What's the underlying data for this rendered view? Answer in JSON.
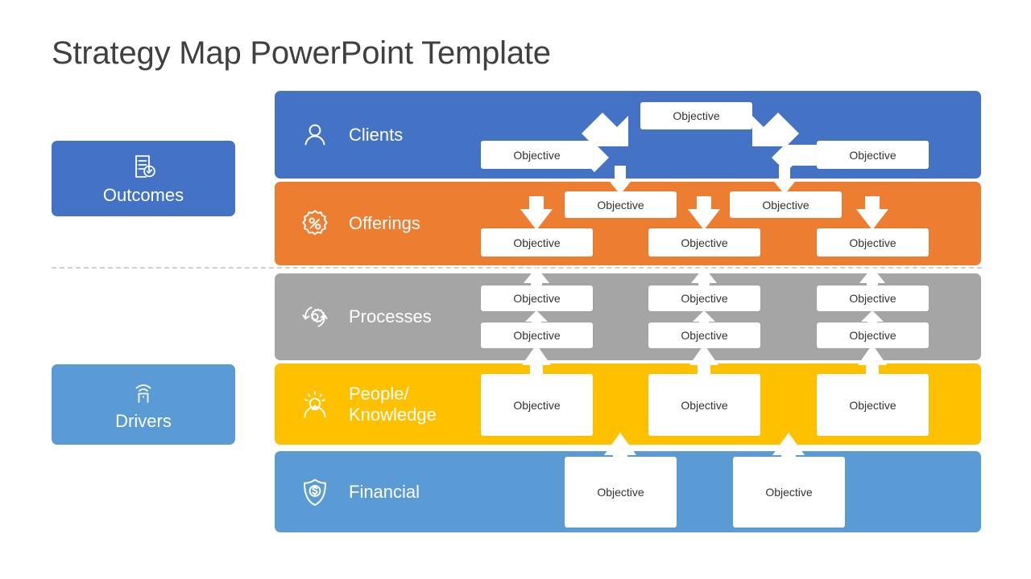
{
  "title": "Strategy Map PowerPoint Template",
  "colors": {
    "title_text": "#404040",
    "outcomes": "#4472C4",
    "drivers": "#5B9BD5",
    "clients": "#4472C4",
    "offerings": "#ED7D31",
    "processes": "#A5A5A5",
    "people": "#FFC000",
    "financial": "#5B9BD5",
    "objective_box": "#FFFFFF",
    "objective_text": "#333333",
    "divider": "#D0D0D0",
    "arrow": "#FFFFFF"
  },
  "categories": [
    {
      "key": "outcomes",
      "label": "Outcomes",
      "icon": "checklist-check-icon"
    },
    {
      "key": "drivers",
      "label": "Drivers",
      "icon": "signal-broadcast-icon"
    }
  ],
  "bands": [
    {
      "key": "clients",
      "label": "Clients",
      "icon": "person-icon"
    },
    {
      "key": "offerings",
      "label": "Offerings",
      "icon": "percent-badge-icon"
    },
    {
      "key": "processes",
      "label": "Processes",
      "icon": "gear-cycle-icon"
    },
    {
      "key": "people",
      "label": "People/\nKnowledge",
      "icon": "lightbulb-person-icon"
    },
    {
      "key": "financial",
      "label": "Financial",
      "icon": "shield-dollar-icon"
    }
  ],
  "objectives": {
    "clients": [
      {
        "id": "clients-top-center",
        "label": "Objective"
      },
      {
        "id": "clients-left",
        "label": "Objective"
      },
      {
        "id": "clients-right",
        "label": "Objective"
      }
    ],
    "offerings": [
      {
        "id": "offerings-upper-left",
        "label": "Objective"
      },
      {
        "id": "offerings-upper-right",
        "label": "Objective"
      },
      {
        "id": "offerings-lower-left",
        "label": "Objective"
      },
      {
        "id": "offerings-lower-center",
        "label": "Objective"
      },
      {
        "id": "offerings-lower-right",
        "label": "Objective"
      }
    ],
    "processes": [
      {
        "id": "processes-upper-left",
        "label": "Objective"
      },
      {
        "id": "processes-upper-center",
        "label": "Objective"
      },
      {
        "id": "processes-upper-right",
        "label": "Objective"
      },
      {
        "id": "processes-lower-left",
        "label": "Objective"
      },
      {
        "id": "processes-lower-center",
        "label": "Objective"
      },
      {
        "id": "processes-lower-right",
        "label": "Objective"
      }
    ],
    "people": [
      {
        "id": "people-left",
        "label": "Objective"
      },
      {
        "id": "people-center",
        "label": "Objective"
      },
      {
        "id": "people-right",
        "label": "Objective"
      }
    ],
    "financial": [
      {
        "id": "financial-left",
        "label": "Objective"
      },
      {
        "id": "financial-right",
        "label": "Objective"
      }
    ]
  }
}
